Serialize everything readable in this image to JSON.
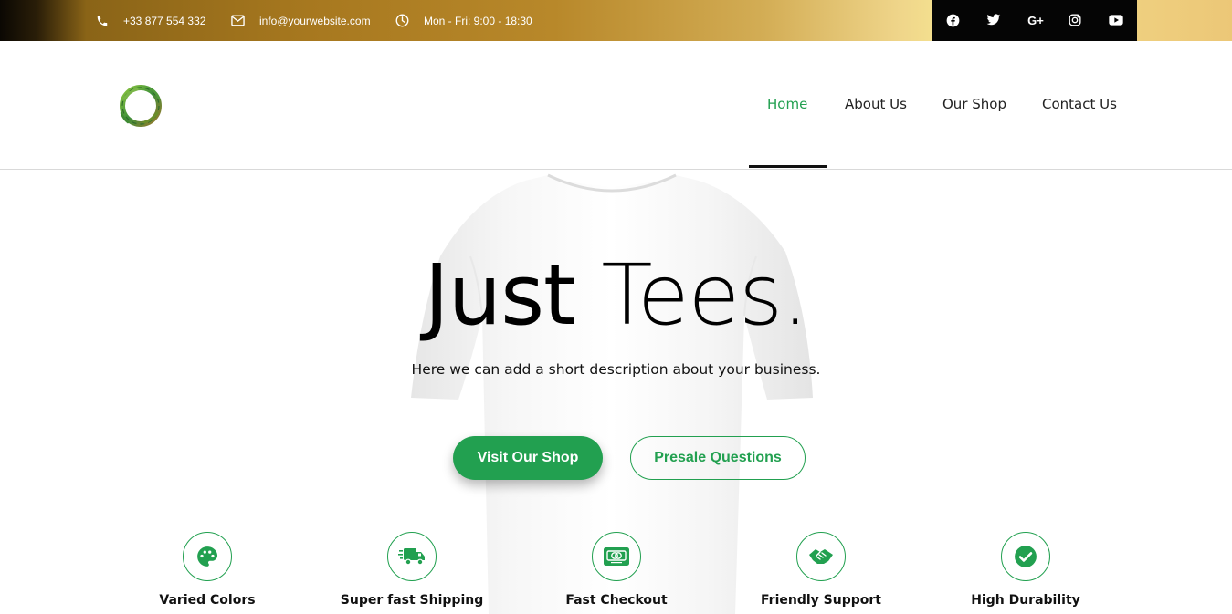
{
  "topbar": {
    "phone": "+33 877 554 332",
    "email": "info@yourwebsite.com",
    "hours": "Mon - Fri: 9:00 - 18:30",
    "social": [
      "facebook-icon",
      "twitter-icon",
      "google-plus-icon",
      "instagram-icon",
      "youtube-icon"
    ],
    "google_plus_text": "G+"
  },
  "nav": {
    "items": [
      {
        "label": "Home",
        "active": true
      },
      {
        "label": "About Us",
        "active": false
      },
      {
        "label": "Our Shop",
        "active": false
      },
      {
        "label": "Contact Us",
        "active": false
      }
    ]
  },
  "hero": {
    "title_bold": "Just",
    "title_light": "Tees.",
    "description": "Here we can add a short description about your business.",
    "primary_button": "Visit Our Shop",
    "secondary_button": "Presale Questions"
  },
  "features": [
    {
      "label": "Varied Colors",
      "icon": "palette-icon"
    },
    {
      "label": "Super fast Shipping",
      "icon": "truck-icon"
    },
    {
      "label": "Fast Checkout",
      "icon": "credit-card-icon"
    },
    {
      "label": "Friendly Support",
      "icon": "handshake-icon"
    },
    {
      "label": "High Durability",
      "icon": "check-circle-icon"
    }
  ],
  "colors": {
    "accent": "#22a050",
    "topbar_dark": "#050505",
    "gold": "#c9a040"
  }
}
